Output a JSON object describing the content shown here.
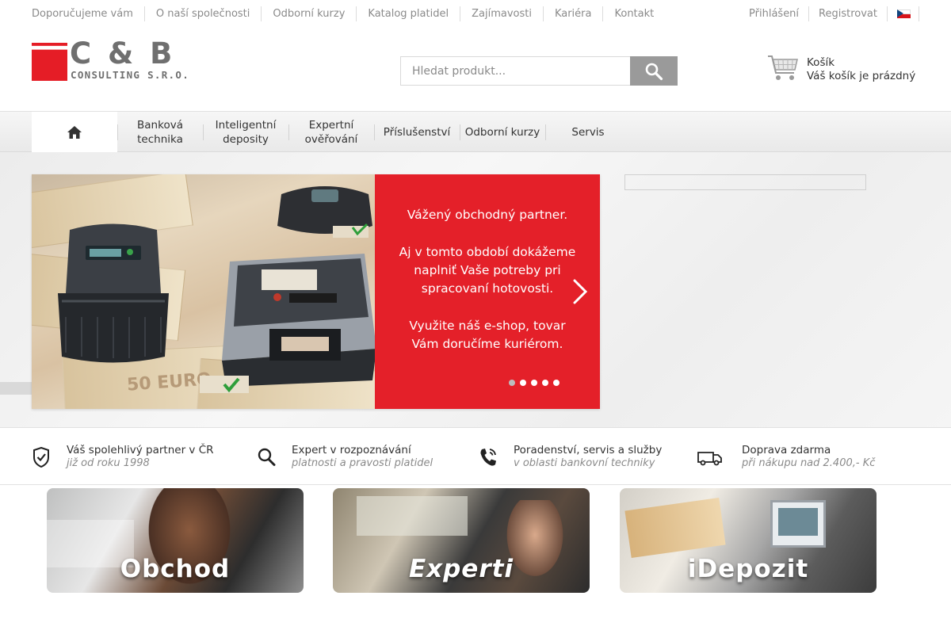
{
  "topnav": {
    "items": [
      "Doporučujeme vám",
      "O naší společnosti",
      "Odborní kurzy",
      "Katalog platidel",
      "Zajímavosti",
      "Kariéra",
      "Kontakt"
    ]
  },
  "account": {
    "login": "Přihlášení",
    "register": "Registrovat"
  },
  "logo": {
    "name": "C & B",
    "sub": "CONSULTING S.R.O."
  },
  "search": {
    "placeholder": "Hledat produkt..."
  },
  "cart": {
    "label": "Košík",
    "status": "Váš košík je prázdný"
  },
  "mainnav": {
    "items": [
      "Banková technika",
      "Inteligentní deposity",
      "Expertní ověřování",
      "Příslušenství",
      "Odborní kurzy",
      "Servis"
    ]
  },
  "slider": {
    "line1": "Vážený obchodný partner.",
    "line2": "Aj v tomto období dokážeme naplniť Vaše potreby pri spracovaní hotovosti.",
    "line3": "Využite náš e-shop, tovar Vám doručíme kuriérom.",
    "note_label": "50 EURO",
    "slides_count": 5,
    "active_slide": 1
  },
  "features": [
    {
      "title": "Váš spolehlivý partner v ČR",
      "sub": "již od roku 1998",
      "icon": "shield-check-icon"
    },
    {
      "title": "Expert v rozpoznávání",
      "sub": "platnosti a pravosti platidel",
      "icon": "search-icon"
    },
    {
      "title": "Poradenství, servis a služby",
      "sub": "v oblasti bankovní techniky",
      "icon": "phone-icon"
    },
    {
      "title": "Doprava zdarma",
      "sub": "při nákupu nad 2.400,- Kč",
      "icon": "van-icon"
    }
  ],
  "tiles": [
    "Obchod",
    "Experti",
    "iDepozit"
  ],
  "colors": {
    "brand_red": "#e51d26",
    "slide_red": "#e42029",
    "muted_text": "#8a8a8a",
    "search_button": "#9a9a9a"
  }
}
